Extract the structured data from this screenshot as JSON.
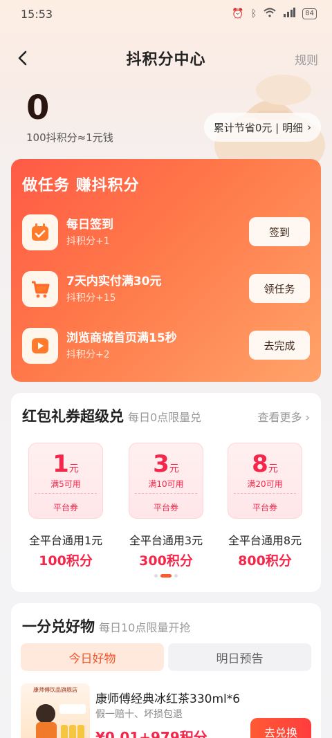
{
  "status_bar": {
    "time": "15:53",
    "battery": "84"
  },
  "nav": {
    "title": "抖积分中心",
    "rules": "规则"
  },
  "points": {
    "value": "0",
    "rate": "100抖积分≈1元钱",
    "savings": "累计节省0元 | 明细",
    "savings_chevron": "›"
  },
  "tasks": {
    "title": "做任务 赚抖积分",
    "items": [
      {
        "name": "每日签到",
        "reward": "抖积分+1",
        "button": "签到",
        "icon": "calendar-icon"
      },
      {
        "name": "7天内实付满30元",
        "reward": "抖积分+15",
        "button": "领任务",
        "icon": "shopping-cart-icon"
      },
      {
        "name": "浏览商城首页满15秒",
        "reward": "抖积分+2",
        "button": "去完成",
        "icon": "video-play-icon"
      }
    ]
  },
  "coupons": {
    "title": "红包礼券超级兑",
    "subtitle": "每日0点限量兑",
    "see_more": "查看更多 ›",
    "items": [
      {
        "amount": "1",
        "unit": "元",
        "condition": "满5可用",
        "type": "平台券",
        "name": "全平台通用1元",
        "cost": "100积分"
      },
      {
        "amount": "3",
        "unit": "元",
        "condition": "满10可用",
        "type": "平台券",
        "name": "全平台通用3元",
        "cost": "300积分"
      },
      {
        "amount": "8",
        "unit": "元",
        "condition": "满20可用",
        "type": "平台券",
        "name": "全平台通用8元",
        "cost": "800积分"
      }
    ]
  },
  "goods": {
    "title": "一分兑好物",
    "subtitle": "每日10点限量开抢",
    "tabs": [
      "今日好物",
      "明日预告"
    ],
    "product": {
      "store": "康师傅饮品旗舰店",
      "name": "康师傅经典冰红茶330ml*6",
      "tags": "假一赔十、坏损包退",
      "price": "¥0.01+979积分",
      "button": "去兑换"
    }
  },
  "colors": {
    "accent": "#f4264a",
    "task_card_start": "#ff5a45",
    "task_card_end": "#ffa36a"
  }
}
